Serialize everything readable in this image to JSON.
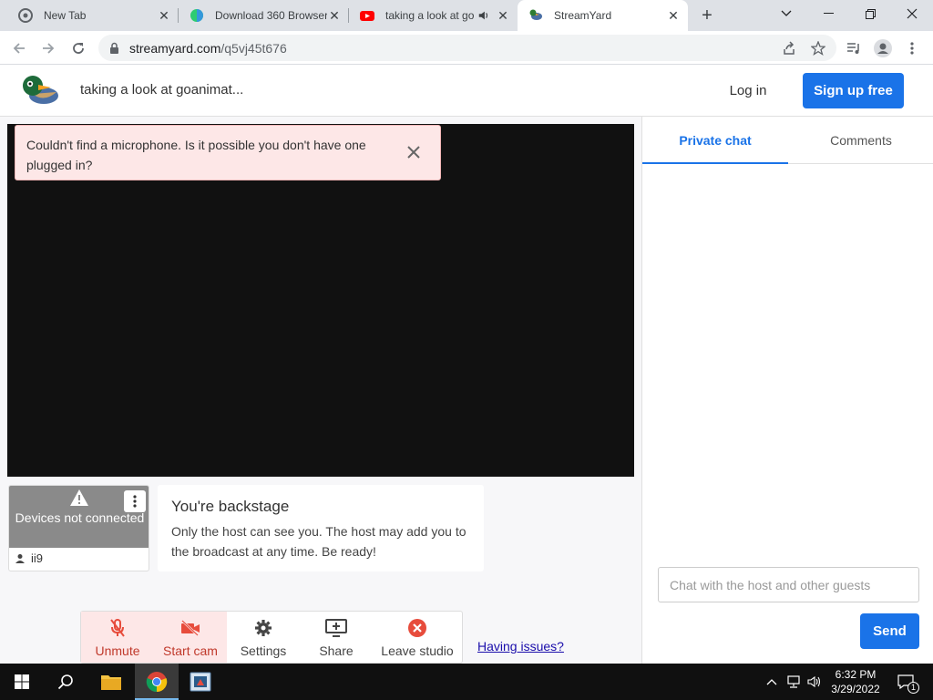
{
  "browser": {
    "tabs": [
      {
        "title": "New Tab",
        "icon": "chrome-icon",
        "active": false
      },
      {
        "title": "Download 360 Browser",
        "icon": "360-browser-icon",
        "active": false
      },
      {
        "title": "taking a look at goanimate",
        "icon": "youtube-icon",
        "active": false,
        "audio": true
      },
      {
        "title": "StreamYard",
        "icon": "streamyard-icon",
        "active": true
      }
    ],
    "url_host": "streamyard.com",
    "url_path": "/q5vj45t676"
  },
  "header": {
    "title": "taking a look at goanimat...",
    "login_label": "Log in",
    "signup_label": "Sign up free"
  },
  "alert": {
    "message": "Couldn't find a microphone. Is it possible you don't have one plugged in?"
  },
  "participant": {
    "status": "Devices not connected",
    "name": "ii9"
  },
  "backstage": {
    "title": "You're backstage",
    "text": "Only the host can see you. The host may add you to the broadcast at any time. Be ready!"
  },
  "controls": [
    {
      "label": "Unmute",
      "icon": "mic-off-icon",
      "style": "red"
    },
    {
      "label": "Start cam",
      "icon": "camera-off-icon",
      "style": "red"
    },
    {
      "label": "Settings",
      "icon": "gear-icon",
      "style": "normal"
    },
    {
      "label": "Share",
      "icon": "share-screen-icon",
      "style": "normal"
    },
    {
      "label": "Leave studio",
      "icon": "leave-icon",
      "style": "normal"
    }
  ],
  "having_issues": "Having issues?",
  "chat": {
    "tabs": [
      "Private chat",
      "Comments"
    ],
    "placeholder": "Chat with the host and other guests",
    "send_label": "Send"
  },
  "taskbar": {
    "time": "6:32 PM",
    "date": "3/29/2022",
    "notification_count": "1"
  },
  "colors": {
    "accent": "#1a73e8",
    "alert_bg": "#fde7e7",
    "danger": "#e74c3c"
  }
}
